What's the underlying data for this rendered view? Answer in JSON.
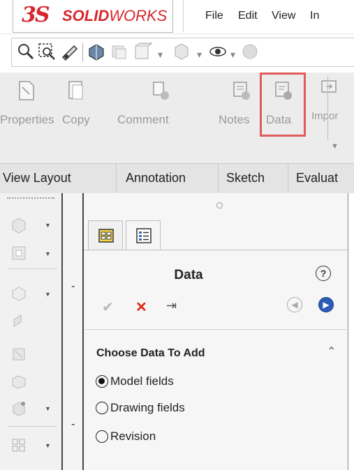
{
  "app": {
    "logo_mark": "3S",
    "logo_bold": "SOLID",
    "logo_light": "WORKS"
  },
  "menu": [
    "File",
    "Edit",
    "View",
    "In"
  ],
  "command_manager": {
    "items": [
      {
        "label": "Properties",
        "icon": "properties-icon"
      },
      {
        "label": "Copy",
        "icon": "copy-icon"
      },
      {
        "label": "Comment",
        "icon": "comment-icon"
      },
      {
        "label": "Notes",
        "icon": "notes-icon"
      },
      {
        "label": "Data",
        "icon": "data-icon",
        "highlighted": true
      },
      {
        "label": "Impor",
        "icon": "import-icon"
      }
    ],
    "highlight_color": "#e15b5b"
  },
  "tabs": [
    "View Layout",
    "Annotation",
    "Sketch",
    "Evaluat"
  ],
  "property_manager": {
    "title": "Data",
    "help": "?",
    "actions": {
      "ok": "✔",
      "cancel": "✕",
      "pin": "⇥"
    },
    "section_title": "Choose Data To Add",
    "options": [
      {
        "label": "Model fields",
        "selected": true
      },
      {
        "label": "Drawing fields",
        "selected": false
      },
      {
        "label": "Revision",
        "selected": false
      }
    ]
  },
  "splitter_marks": [
    "-",
    "-"
  ],
  "colors": {
    "brand": "#d6272e",
    "cancel": "#e0261b",
    "nav_active": "#2b5bb8"
  }
}
